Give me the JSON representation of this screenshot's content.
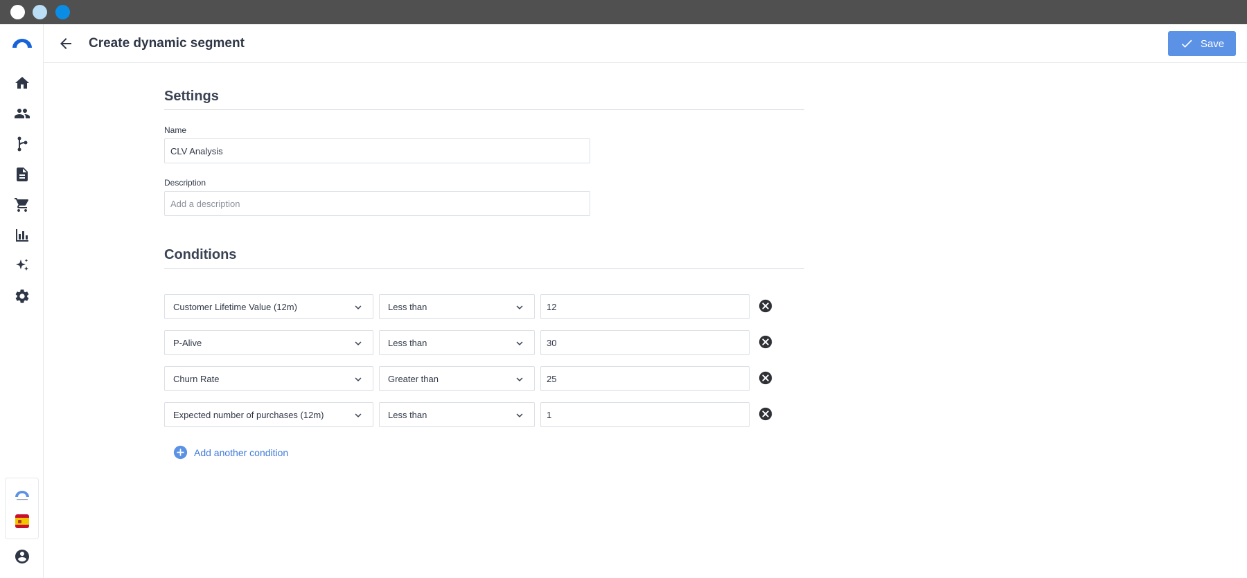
{
  "header": {
    "title": "Create dynamic segment",
    "save_label": "Save"
  },
  "sidebar": {
    "items": [
      {
        "name": "home",
        "icon": "home-icon"
      },
      {
        "name": "customers",
        "icon": "people-icon"
      },
      {
        "name": "journeys",
        "icon": "flow-branch-icon"
      },
      {
        "name": "reports",
        "icon": "document-icon"
      },
      {
        "name": "commerce",
        "icon": "cart-icon"
      },
      {
        "name": "analytics",
        "icon": "bar-chart-icon"
      },
      {
        "name": "ai",
        "icon": "sparkles-icon"
      },
      {
        "name": "settings",
        "icon": "gear-icon"
      }
    ],
    "language_flag": "es"
  },
  "settings": {
    "title": "Settings",
    "name_label": "Name",
    "name_value": "CLV Analysis",
    "description_label": "Description",
    "description_placeholder": "Add a description"
  },
  "conditions": {
    "title": "Conditions",
    "rows": [
      {
        "attribute": "Customer Lifetime Value (12m)",
        "operator": "Less than",
        "value": "12"
      },
      {
        "attribute": "P-Alive",
        "operator": "Less than",
        "value": "30"
      },
      {
        "attribute": "Churn Rate",
        "operator": "Greater than",
        "value": "25"
      },
      {
        "attribute": "Expected number of purchases (12m)",
        "operator": "Less than",
        "value": "1"
      }
    ],
    "add_label": "Add another condition"
  },
  "colors": {
    "accent": "#5b92e5",
    "link": "#3f7ad9",
    "text": "#2f3747",
    "titlebar": "#505050"
  }
}
